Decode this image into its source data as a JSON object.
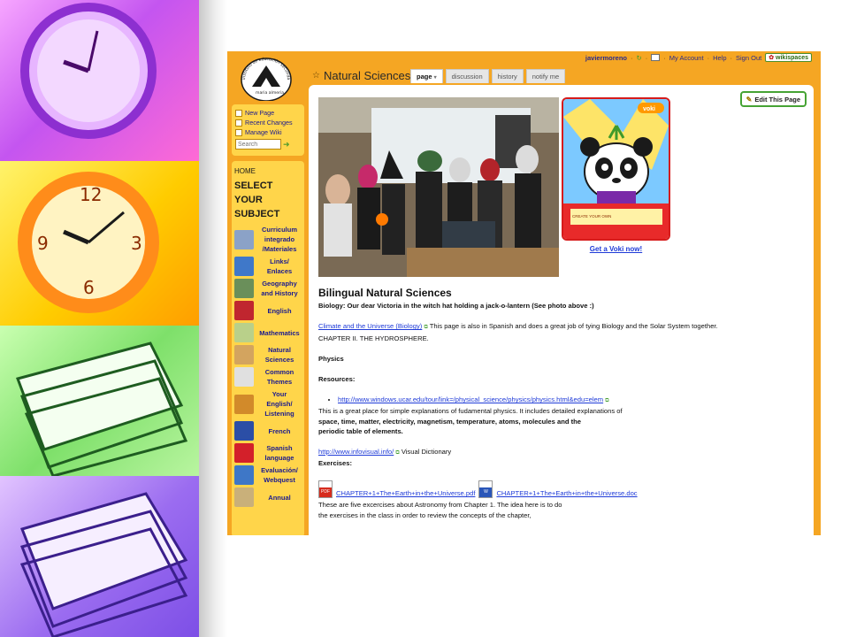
{
  "topbar": {
    "username": "javiermoreno",
    "my_account": "My Account",
    "help": "Help",
    "sign_out": "Sign Out",
    "sep": "·",
    "badge": "wikispaces"
  },
  "page": {
    "title": "Natural Sciences",
    "tabs": [
      "page",
      "discussion",
      "history",
      "notify me"
    ],
    "active_tab": "page",
    "tab_caret": "▾",
    "edit_button": "Edit This Page"
  },
  "sidebar": {
    "quick_links": [
      "New Page",
      "Recent Changes",
      "Manage Wiki"
    ],
    "search_placeholder": "Search",
    "home": "HOME",
    "nav_title": "SELECT\nYOUR\nSUBJECT",
    "items": [
      {
        "label": "Curriculum\nintegrado\n/Materiales",
        "thumb_color": "#8ba2c7"
      },
      {
        "label": "Links/\nEnlaces",
        "thumb_color": "#3f78c9"
      },
      {
        "label": "Geography\nand History",
        "thumb_color": "#6a8f5a"
      },
      {
        "label": "English",
        "thumb_color": "#c0262f"
      },
      {
        "label": "Mathematics",
        "thumb_color": "#b9d08a"
      },
      {
        "label": "Natural\nSciences",
        "thumb_color": "#d3a45f"
      },
      {
        "label": "Common\nThemes",
        "thumb_color": "#e0e0e0"
      },
      {
        "label": "Your\nEnglish/\nListening",
        "thumb_color": "#d28a2a"
      },
      {
        "label": "French",
        "thumb_color": "#2b4ea6"
      },
      {
        "label": "Spanish\nlanguage",
        "thumb_color": "#d3202a"
      },
      {
        "label": "Evaluación/\nWebquest",
        "thumb_color": "#3e77c7"
      },
      {
        "label": "Annual",
        "thumb_color": "#c9b07a"
      }
    ]
  },
  "voki": {
    "link": "Get a Voki now!",
    "badge": "voki",
    "create_label": "CREATE YOUR OWN"
  },
  "logo": {
    "arc_text": "instituto de educación secundaria",
    "bottom_text": "maria almeria"
  },
  "article": {
    "heading": "Bilingual Natural Sciences",
    "caption": "Biology: Our dear Victoria in the witch hat holding a jack-o-lantern (See photo above :)",
    "link1": "Climate and the Universe (Biology)",
    "link1_desc": " This page is also in Spanish and does a great job of tying Biology and the Solar System together.",
    "chapter": "CHAPTER II. THE HYDROSPHERE.",
    "physics": "Physics",
    "resources": "Resources:",
    "link2": "http://www.windows.ucar.edu/tour/link=/physical_science/physics/physics.html&edu=elem",
    "link2_desc_1": "This is a great place for simple explanations of fudamental physics. It includes detailed explanations of",
    "link2_desc_2": "space, time, matter, electricity, magnetism, temperature, atoms, molecules and the",
    "link2_desc_3": "periodic table of elements.",
    "link3": "http://www.infovisual.info/",
    "link3_desc": " Visual Dictionary",
    "exercises": "Exercises:",
    "pdf_file": "CHAPTER+1+The+Earth+in+the+Universe.pdf",
    "doc_file": "CHAPTER+1+The+Earth+in+the+Universe.doc",
    "ex_desc_1": "These are five excercises about Astronomy from Chapter 1. The idea here is to do",
    "ex_desc_2": "the exercises in the class in order to review the concepts of the chapter,"
  }
}
